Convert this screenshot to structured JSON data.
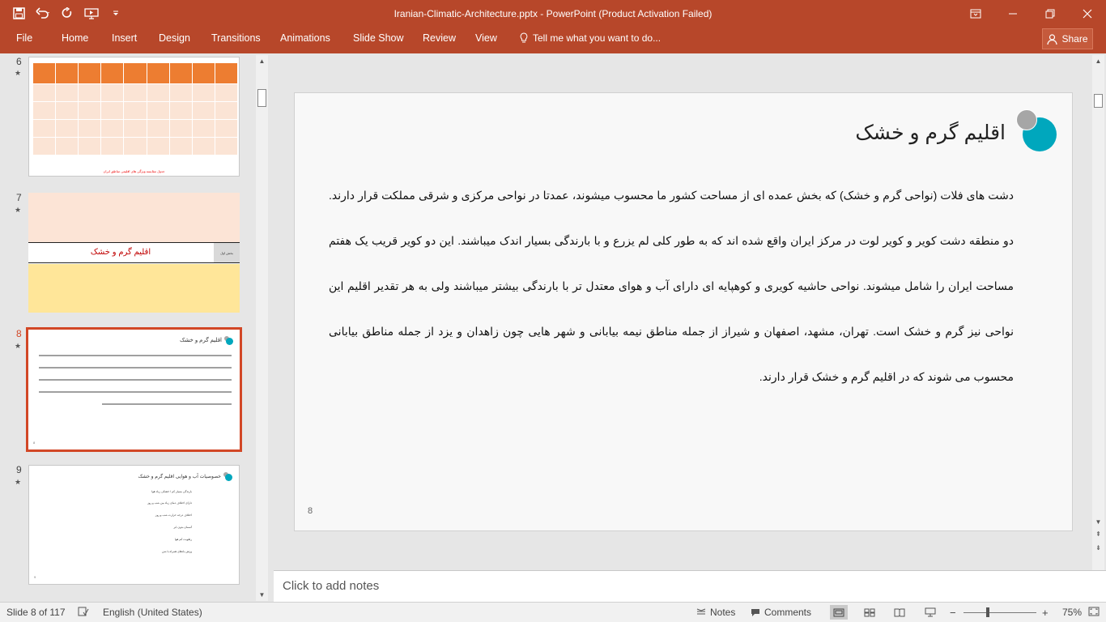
{
  "app": {
    "window_title": "Iranian-Climatic-Architecture.pptx - PowerPoint (Product Activation Failed)",
    "accent_color": "#b7472a"
  },
  "quick_access": {
    "save_icon": "save-icon",
    "undo_icon": "undo-icon",
    "redo_icon": "redo-icon",
    "presenter_icon": "start-from-beginning-icon",
    "customize_icon": "customize-qat-icon"
  },
  "ribbon": {
    "tabs": [
      "File",
      "Home",
      "Insert",
      "Design",
      "Transitions",
      "Animations",
      "Slide Show",
      "Review",
      "View"
    ],
    "tell_me": "Tell me what you want to do...",
    "share": "Share"
  },
  "thumbnails": {
    "items": [
      {
        "number": "6",
        "star": "★"
      },
      {
        "number": "7",
        "star": "★",
        "title": "اقلیم گرم و خشک",
        "side_label": "بخش اول"
      },
      {
        "number": "8",
        "star": "★",
        "title": "اقلیم گرم و خشک",
        "slide_number": "8",
        "selected": true
      },
      {
        "number": "9",
        "star": "★",
        "title": "خصوصیات آب و هوایی اقلیم گرم و خشک",
        "slide_number": "9",
        "bullets": [
          "بارندگی بسیار کم / خشکی زیاد هوا",
          "دارای اختلاف دمای زیاد بین شب و روز",
          "اختلاف درجه حرارت شب و روز",
          "آسمان بدون ابر",
          "رطوبت کم هوا",
          "وزش بادهای همراه با شن"
        ]
      }
    ],
    "slide6_caption": "جدول مقایسه ویژگی های اقلیمی مناطق ایران"
  },
  "slide": {
    "title": "اقلیم گرم و خشک",
    "body": "دشت های فلات (نواحی گرم و خشک) که بخش عمده ای از مساحت کشور ما محسوب میشوند، عمدتا در نواحی مرکزی و شرقی مملکت قرار دارند. دو منطقه دشت کویر و کویر لوت در مرکز ایران واقع شده اند که به طور کلی لم یزرع و با بارندگی بسیار اندک میباشند. این دو کویر قریب یک هفتم مساحت ایران را شامل میشوند. نواحی حاشیه کویری و کوهپایه ای دارای آب و هوای معتدل تر با بارندگی بیشتر میباشند ولی به هر تقدیر اقلیم این نواحی نیز گرم و خشک است. تهران، مشهد، اصفهان و شیراز از جمله مناطق نیمه بیابانی و شهر هایی چون زاهدان و یزد از جمله مناطق بیابانی محسوب می شوند که در اقلیم گرم و خشک قرار دارند.",
    "number": "8",
    "circle_colors": [
      "#00a7bd",
      "#a6a6a6"
    ]
  },
  "notes": {
    "placeholder": "Click to add notes"
  },
  "status": {
    "slide_info": "Slide 8 of 117",
    "language": "English (United States)",
    "notes": "Notes",
    "comments": "Comments",
    "zoom_minus": "−",
    "zoom_plus": "+",
    "zoom": "75%"
  }
}
